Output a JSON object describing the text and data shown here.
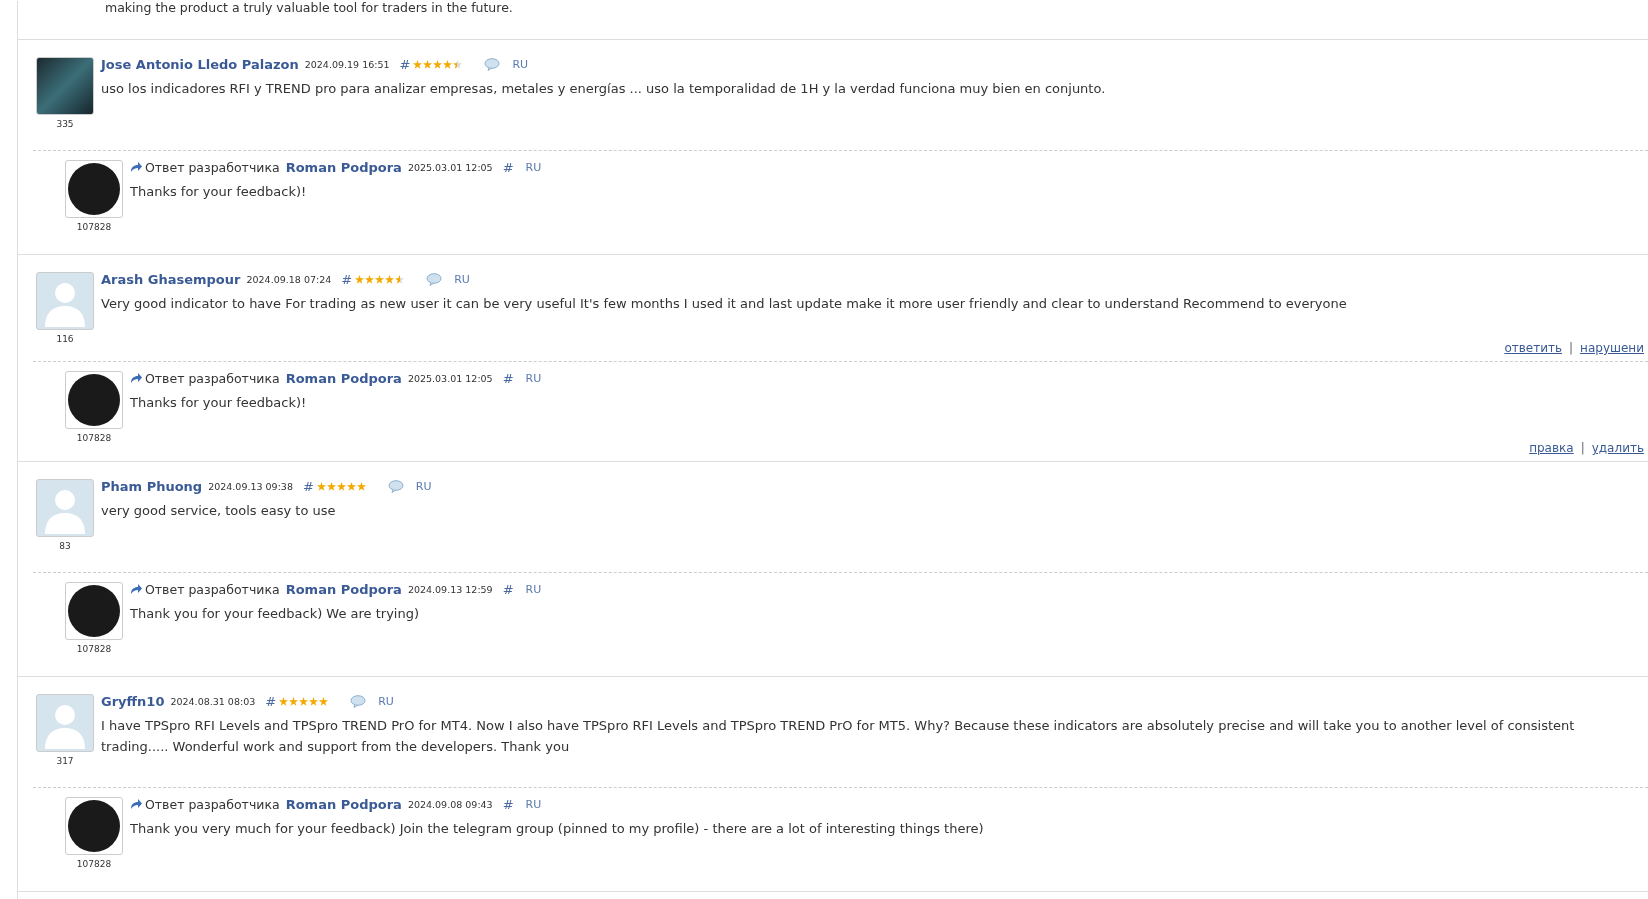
{
  "top_text": "making the product a truly valuable tool for traders in the future.",
  "reviews": [
    {
      "author": "Jose Antonio Lledo Palazon",
      "date": "2024.09.19 16:51",
      "hash": "#",
      "stars": 4.5,
      "lang": "RU",
      "text": "uso los indicadores RFI y TREND pro para analizar empresas, metales y energías ... uso la temporalidad de 1H y la verdad funciona muy bien en conjunto.",
      "count": "335",
      "avatar": {
        "kind": "image"
      },
      "reply": {
        "label": "Ответ разработчика",
        "author": "Roman Podpora",
        "date": "2025.03.01 12:05",
        "hash": "#",
        "lang": "RU",
        "text": "Thanks for your feedback)!",
        "count": "107828",
        "avatar": {
          "kind": "logo"
        }
      }
    },
    {
      "author": "Arash Ghasempour",
      "date": "2024.09.18 07:24",
      "hash": "#",
      "stars": 4.5,
      "lang": "RU",
      "text": "Very good indicator to have For trading as new user it can be very useful It's few months I used it and last update make it more user friendly and clear to understand Recommend to everyone",
      "count": "116",
      "avatar": {
        "kind": "default"
      },
      "actions": {
        "links": [
          "ответить",
          "нарушени"
        ],
        "separator": "|"
      },
      "reply": {
        "label": "Ответ разработчика",
        "author": "Roman Podpora",
        "date": "2025.03.01 12:05",
        "hash": "#",
        "lang": "RU",
        "text": "Thanks for your feedback)!",
        "count": "107828",
        "avatar": {
          "kind": "logo"
        },
        "actions": {
          "links": [
            "правка",
            "удалить"
          ],
          "separator": "|"
        }
      }
    },
    {
      "author": "Pham Phuong",
      "date": "2024.09.13 09:38",
      "hash": "#",
      "stars": 5,
      "lang": "RU",
      "text": "very good service, tools easy to use",
      "count": "83",
      "avatar": {
        "kind": "default"
      },
      "reply": {
        "label": "Ответ разработчика",
        "author": "Roman Podpora",
        "date": "2024.09.13 12:59",
        "hash": "#",
        "lang": "RU",
        "text": "Thank you for your feedback) We are trying)",
        "count": "107828",
        "avatar": {
          "kind": "logo"
        }
      }
    },
    {
      "author": "Gryffn10",
      "date": "2024.08.31 08:03",
      "hash": "#",
      "stars": 5,
      "lang": "RU",
      "text": "I have TPSpro RFI Levels and TPSpro TREND PrO for MT4. Now I also have TPSpro RFI Levels and TPSpro TREND PrO for MT5. Why? Because these indicators are absolutely precise and will take you to another level of consistent trading..... Wonderful work and support from the developers. Thank you",
      "count": "317",
      "avatar": {
        "kind": "default"
      },
      "reply": {
        "label": "Ответ разработчика",
        "author": "Roman Podpora",
        "date": "2024.09.08 09:43",
        "hash": "#",
        "lang": "RU",
        "text": "Thank you very much for your feedback) Join the telegram group (pinned to my profile) - there are a lot of interesting things there)",
        "count": "107828",
        "avatar": {
          "kind": "logo"
        }
      }
    }
  ]
}
